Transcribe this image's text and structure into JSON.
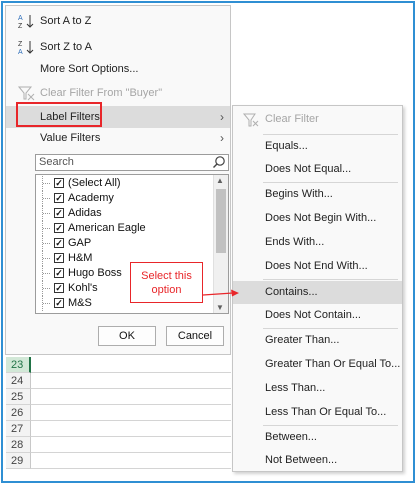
{
  "menu": {
    "sort_az": "Sort A to Z",
    "sort_za": "Sort Z to A",
    "more_sort": "More Sort Options...",
    "clear_filter": "Clear Filter From \"Buyer\"",
    "label_filters": "Label Filters",
    "value_filters": "Value Filters",
    "search_placeholder": "Search",
    "items": [
      "(Select All)",
      "Academy",
      "Adidas",
      "American Eagle",
      "GAP",
      "H&M",
      "Hugo Boss",
      "Kohl's",
      "M&S"
    ],
    "ok": "OK",
    "cancel": "Cancel"
  },
  "submenu": {
    "clear": "Clear Filter",
    "items": [
      "Equals...",
      "Does Not Equal...",
      "Begins With...",
      "Does Not Begin With...",
      "Ends With...",
      "Does Not End With...",
      "Contains...",
      "Does Not Contain...",
      "Greater Than...",
      "Greater Than Or Equal To...",
      "Less Than...",
      "Less Than Or Equal To...",
      "Between...",
      "Not Between..."
    ]
  },
  "rows": [
    "23",
    "24",
    "25",
    "26",
    "27",
    "28",
    "29"
  ],
  "callout": {
    "line1": "Select this",
    "line2": "option"
  },
  "colors": {
    "accent_red": "#e8262a",
    "frame_blue": "#2f8fd3",
    "excel_green": "#217346"
  }
}
